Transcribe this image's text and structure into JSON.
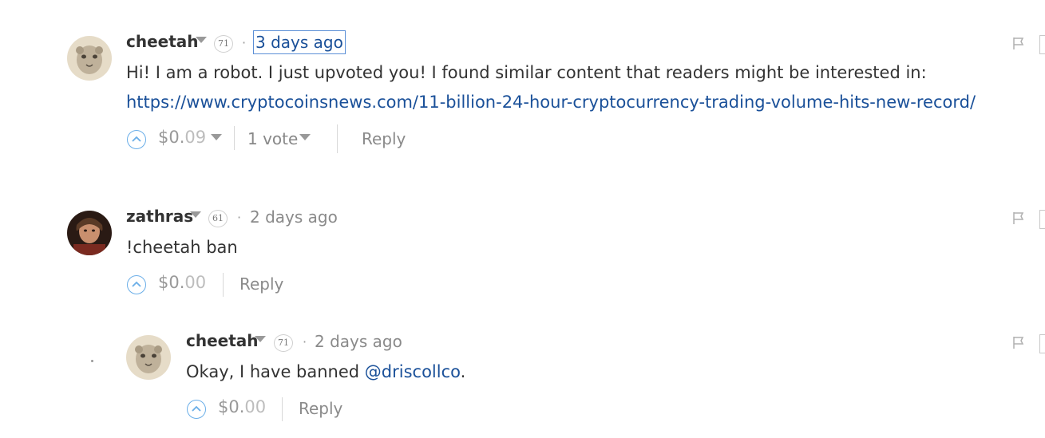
{
  "comments": [
    {
      "author": "cheetah",
      "reputation": "71",
      "separator": "·",
      "time": "3 days ago",
      "body_text": "Hi! I am a robot. I just upvoted you! I found similar content that readers might be interested in:",
      "link": "https://www.cryptocoinsnews.com/11-billion-24-hour-cryptocurrency-trading-volume-hits-new-record/",
      "payout_main": "$0.",
      "payout_cents": "09",
      "votes": "1 vote",
      "reply": "Reply"
    },
    {
      "author": "zathras",
      "reputation": "61",
      "separator": "·",
      "time": "2 days ago",
      "body_text": "!cheetah ban",
      "payout_main": "$0.",
      "payout_cents": "00",
      "reply": "Reply"
    },
    {
      "author": "cheetah",
      "reputation": "71",
      "separator": "·",
      "time": "2 days ago",
      "body_prefix": "Okay, I have banned ",
      "mention": "@driscollco",
      "body_suffix": ".",
      "payout_main": "$0.",
      "payout_cents": "00",
      "reply": "Reply"
    }
  ],
  "colors": {
    "link": "#1a5099",
    "upvote": "#6aaee8",
    "muted": "#8a8a8a"
  },
  "icons": [
    "flag-icon",
    "upvote-icon",
    "caret-down-icon"
  ]
}
